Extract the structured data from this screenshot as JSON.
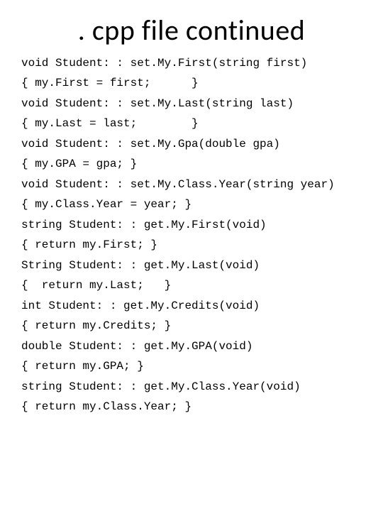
{
  "title": ". cpp file continued",
  "code": {
    "l1": "void Student: : set.My.First(string first)",
    "l2": "{ my.First = first;      }",
    "l3": "void Student: : set.My.Last(string last)",
    "l4": "{ my.Last = last;        }",
    "l5": "void Student: : set.My.Gpa(double gpa)",
    "l6": "{ my.GPA = gpa; }",
    "l7": "void Student: : set.My.Class.Year(string year)",
    "l8": "{ my.Class.Year = year; }",
    "l9": "string Student: : get.My.First(void)",
    "l10": "{ return my.First; }",
    "l11": "String Student: : get.My.Last(void)",
    "l12": "{  return my.Last;   }",
    "l13": "int Student: : get.My.Credits(void)",
    "l14": "{ return my.Credits; }",
    "l15": "double Student: : get.My.GPA(void)",
    "l16": "{ return my.GPA; }",
    "l17": "string Student: : get.My.Class.Year(void)",
    "l18": "{ return my.Class.Year; }"
  }
}
